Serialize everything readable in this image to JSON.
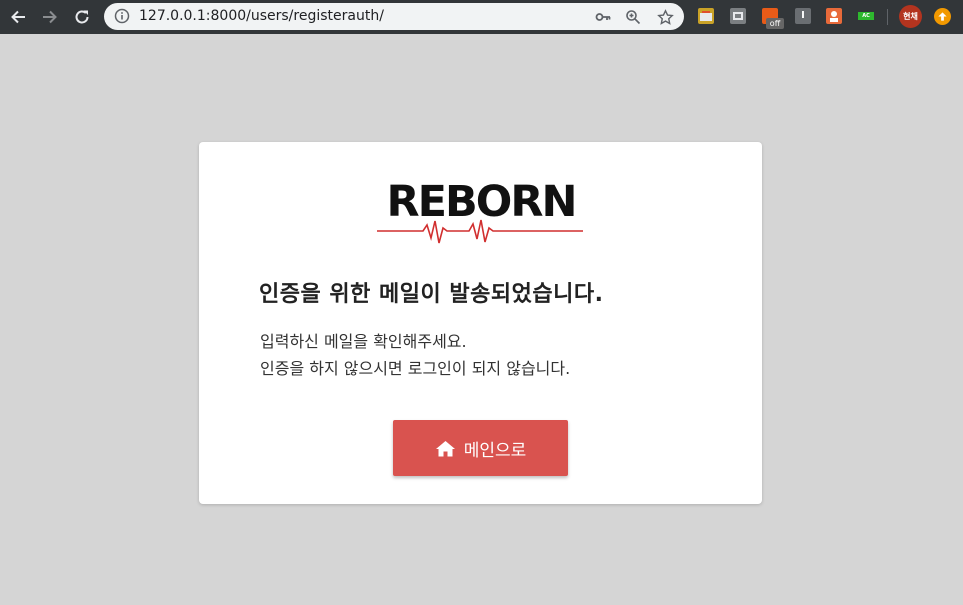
{
  "browser": {
    "url": "127.0.0.1:8000/users/registerauth/",
    "extension_off_badge": "off",
    "extension_ac_badge": "AC",
    "profile_name": "현채"
  },
  "logo": {
    "text": "REBORN",
    "color": "#111111",
    "pulse_color": "#d12f2f"
  },
  "card": {
    "heading": "인증을 위한 메일이 발송되었습니다.",
    "message_line1": "입력하신 메일을 확인해주세요.",
    "message_line2": "인증을 하지 않으시면 로그인이 되지 않습니다.",
    "main_button_label": "메인으로",
    "main_button_icon": "home-icon",
    "accent_color": "#d9534f"
  }
}
